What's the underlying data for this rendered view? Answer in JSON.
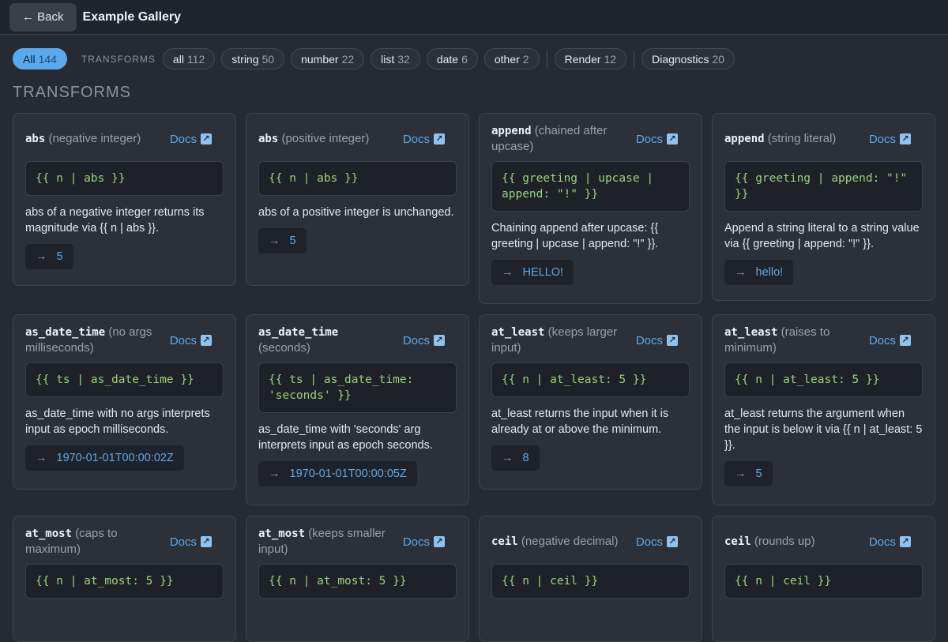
{
  "topbar": {
    "back_label": "← Back",
    "title": "Example Gallery"
  },
  "filters": {
    "all": {
      "label": "All",
      "count": "144"
    },
    "transforms_label": "TRANSFORMS",
    "transform_chips": [
      {
        "label": "all",
        "count": "112"
      },
      {
        "label": "string",
        "count": "50"
      },
      {
        "label": "number",
        "count": "22"
      },
      {
        "label": "list",
        "count": "32"
      },
      {
        "label": "date",
        "count": "6"
      },
      {
        "label": "other",
        "count": "2"
      }
    ],
    "render": {
      "label": "Render",
      "count": "12"
    },
    "diagnostics": {
      "label": "Diagnostics",
      "count": "20"
    }
  },
  "section_title": "TRANSFORMS",
  "docs_label": "Docs",
  "result_arrow": "→",
  "cards": [
    {
      "fn": "abs",
      "variant": "(negative integer)",
      "code": "{{ n | abs }}",
      "desc": "abs of a negative integer returns its magnitude via {{ n | abs }}.",
      "result": "5"
    },
    {
      "fn": "abs",
      "variant": "(positive integer)",
      "code": "{{ n | abs }}",
      "desc": "abs of a positive integer is unchanged.",
      "result": "5"
    },
    {
      "fn": "append",
      "variant": "(chained after upcase)",
      "code": "{{ greeting | upcase |\nappend: \"!\" }}",
      "desc": "Chaining append after upcase: {{ greeting | upcase | append: \"!\" }}.",
      "result": "HELLO!"
    },
    {
      "fn": "append",
      "variant": "(string literal)",
      "code": "{{ greeting | append: \"!\"\n}}",
      "desc": "Append a string literal to a string value via {{ greeting | append: \"!\" }}.",
      "result": "hello!"
    },
    {
      "fn": "as_date_time",
      "variant": "(no args milliseconds)",
      "code": "{{ ts | as_date_time }}",
      "desc": "as_date_time with no args interprets input as epoch milliseconds.",
      "result": "1970-01-01T00:00:02Z"
    },
    {
      "fn": "as_date_time",
      "variant": "(seconds)",
      "code": "{{ ts | as_date_time:\n'seconds' }}",
      "desc": "as_date_time with 'seconds' arg interprets input as epoch seconds.",
      "result": "1970-01-01T00:00:05Z"
    },
    {
      "fn": "at_least",
      "variant": "(keeps larger input)",
      "code": "{{ n | at_least: 5 }}",
      "desc": "at_least returns the input when it is already at or above the minimum.",
      "result": "8"
    },
    {
      "fn": "at_least",
      "variant": "(raises to minimum)",
      "code": "{{ n | at_least: 5 }}",
      "desc": "at_least returns the argument when the input is below it via {{ n | at_least: 5 }}.",
      "result": "5"
    },
    {
      "fn": "at_most",
      "variant": "(caps to maximum)",
      "code": "{{ n | at_most: 5 }}",
      "desc": "",
      "result": ""
    },
    {
      "fn": "at_most",
      "variant": "(keeps smaller input)",
      "code": "{{ n | at_most: 5 }}",
      "desc": "",
      "result": ""
    },
    {
      "fn": "ceil",
      "variant": "(negative decimal)",
      "code": "{{ n | ceil }}",
      "desc": "",
      "result": ""
    },
    {
      "fn": "ceil",
      "variant": "(rounds up)",
      "code": "{{ n | ceil }}",
      "desc": "",
      "result": ""
    }
  ]
}
